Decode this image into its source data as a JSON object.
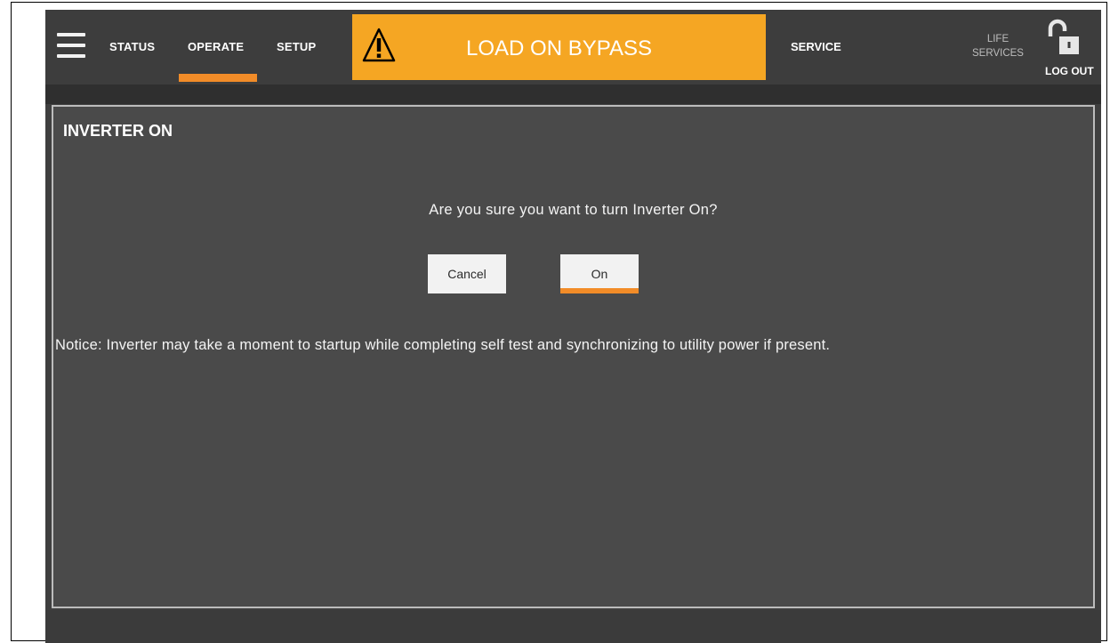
{
  "nav": {
    "tabs": [
      {
        "label": "STATUS"
      },
      {
        "label": "OPERATE",
        "active": true
      },
      {
        "label": "SETUP"
      }
    ],
    "service_label": "SERVICE",
    "life_services_line1": "LIFE",
    "life_services_line2": "SERVICES",
    "logout_label": "LOG OUT"
  },
  "alarm": {
    "text": "LOAD ON BYPASS",
    "color": "#f5a623",
    "icon": "warning-triangle-icon"
  },
  "panel": {
    "title": "INVERTER ON",
    "question": "Are you sure you want to turn Inverter On?",
    "cancel_label": "Cancel",
    "on_label": "On",
    "notice": "Notice: Inverter may take a moment to startup while completing self test and synchronizing to utility power if present."
  },
  "colors": {
    "accent": "#f28c28",
    "background": "#3f3f3f"
  }
}
